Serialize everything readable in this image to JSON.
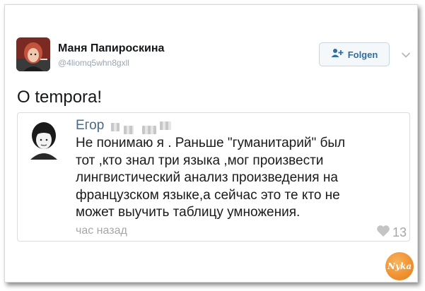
{
  "tweet": {
    "author_name": "Маня Папироскина",
    "author_handle": "@4liomq5whn8gxll",
    "follow_label": "Folgen",
    "text": "O tempora!"
  },
  "quote": {
    "author": "Егор",
    "lines": [
      "Не понимаю я . Раньше \"гуманитарий\" был",
      "тот ,кто знал три языка ,мог произвести",
      "лингвистический анализ произведения на",
      "французском языке,а сейчас это те кто не",
      "может выучить таблицу умножения."
    ],
    "time": "час назад",
    "likes": "13"
  },
  "watermark": {
    "text": "Nyka",
    "color": "#e97a17"
  },
  "colors": {
    "link": "#2d6ea3",
    "muted": "#a7a7a7"
  }
}
